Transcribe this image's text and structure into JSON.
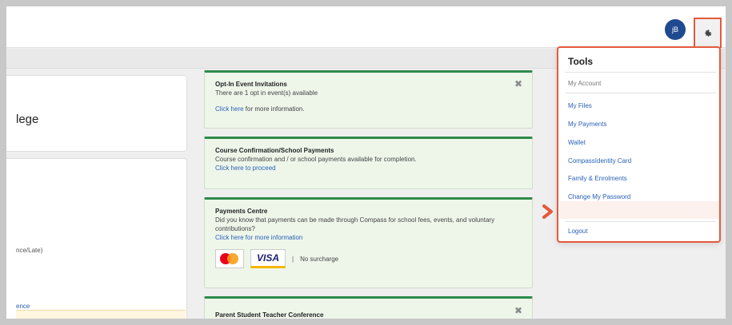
{
  "header": {
    "avatar_initials": "jB"
  },
  "left": {
    "college_fragment": "lege",
    "late_fragment": "nce/Late)",
    "link_fragment": "ence"
  },
  "cards": [
    {
      "title": "Opt-In Event Invitations",
      "text": "There are 1 opt in event(s) available",
      "link": "Click here",
      "suffix": " for more information.",
      "closable": true
    },
    {
      "title": "Course Confirmation/School Payments",
      "text": "Course confirmation and / or school payments available for completion.",
      "link": "Click here to proceed"
    },
    {
      "title": "Payments Centre",
      "text": "Did you know that payments can be made through Compass for school fees, events, and voluntary contributions?",
      "link": "Click here for more information",
      "visa": "VISA",
      "separator": "|",
      "surcharge": "No surcharge"
    },
    {
      "title": "Parent Student Teacher Conference",
      "closable": true
    }
  ],
  "tools_menu": {
    "title": "Tools",
    "section_heading": "My Account",
    "items": [
      "My Files",
      "My Payments",
      "Wallet",
      "CompassIdentity Card",
      "Family & Enrolments",
      "Change My Password"
    ],
    "logout": "Logout"
  },
  "icons": {
    "close": "close-icon",
    "gear": "gear-icon",
    "arrow": "chevron-right-icon"
  },
  "colors": {
    "highlight": "#e45a3c",
    "card_border": "#2e8a4c",
    "link": "#2a62b8",
    "avatar": "#1f4a8f"
  }
}
